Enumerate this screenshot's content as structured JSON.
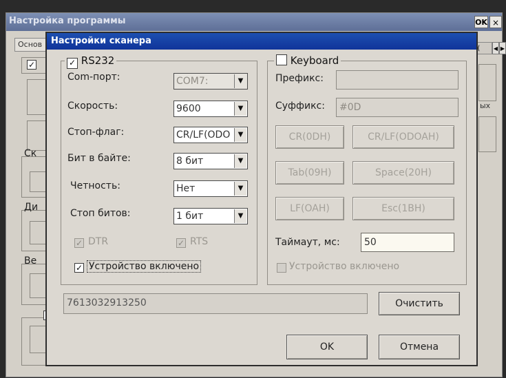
{
  "background_window": {
    "title": "Настройка программы",
    "ok_label": "OK",
    "close_label": "×",
    "tab_label": "Основ",
    "right_tab_text": "\\(",
    "right_text": "ых",
    "left_labels": [
      "Ск",
      "Ди",
      "Ве"
    ]
  },
  "dialog": {
    "title": "Настройки сканера",
    "rs232": {
      "legend": "RS232",
      "checked": true,
      "com_port": {
        "label": "Com-порт:",
        "value": "COM7:"
      },
      "speed": {
        "label": "Скорость:",
        "value": "9600"
      },
      "stop_flag": {
        "label": "Стоп-флаг:",
        "value": "CR/LF(ODO"
      },
      "bits_per_byte": {
        "label": "Бит в байте:",
        "value": "8 бит"
      },
      "parity": {
        "label": "Четность:",
        "value": "Нет"
      },
      "stop_bits": {
        "label": "Стоп битов:",
        "value": "1 бит"
      },
      "dtr_label": "DTR",
      "rts_label": "RTS",
      "device_enabled_label": "Устройство включено"
    },
    "keyboard": {
      "legend": "Keyboard",
      "checked": false,
      "prefix": {
        "label": "Префикс:",
        "value": ""
      },
      "suffix": {
        "label": "Суффикс:",
        "value": "#0D"
      },
      "buttons": [
        "CR(0DH)",
        "CR/LF(ODOAH)",
        "Tab(09H)",
        "Space(20H)",
        "LF(OAH)",
        "Esc(1BH)"
      ],
      "timeout": {
        "label": "Таймаут, мс:",
        "value": "50"
      },
      "device_enabled_label": "Устройство включено"
    },
    "scan_result": "7613032913250",
    "clear_label": "Очистить",
    "ok_label": "OK",
    "cancel_label": "Отмена"
  }
}
